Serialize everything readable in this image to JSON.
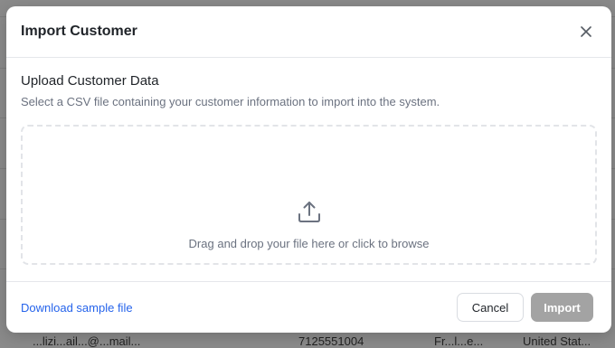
{
  "dialog": {
    "title": "Import Customer",
    "close_label": "×"
  },
  "body": {
    "section_title": "Upload Customer Data",
    "section_description": "Select a CSV file containing your customer information to import into the system.",
    "dropzone_text": "Drag and drop your file here or click to browse",
    "dropzone_icon": "upload-icon"
  },
  "footer": {
    "download_link": "Download sample file",
    "cancel_label": "Cancel",
    "import_label": "Import",
    "import_disabled": true
  },
  "background": {
    "row_fragments": [
      "...lizi...ail...@...mail...",
      "7125551004",
      "Fr...l...e...",
      "United Stat..."
    ]
  },
  "colors": {
    "overlay": "#8a8a8a",
    "link": "#2563eb",
    "import_disabled": "#a3a3a3"
  }
}
